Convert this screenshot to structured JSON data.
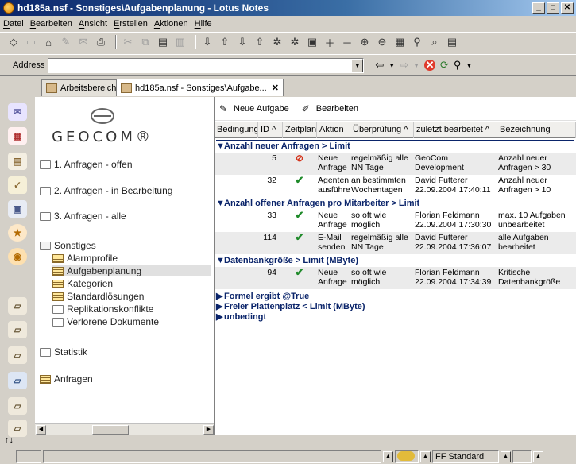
{
  "window": {
    "title": "hd185a.nsf - Sonstiges\\Aufgabenplanung - Lotus Notes",
    "min_label": "_",
    "max_label": "□",
    "close_label": "✕"
  },
  "menu": [
    "Datei",
    "Bearbeiten",
    "Ansicht",
    "Erstellen",
    "Aktionen",
    "Hilfe"
  ],
  "toolbar": {
    "icons": [
      "diamond-icon",
      "save-icon",
      "open-icon",
      "edit-icon",
      "mail-icon",
      "print-icon",
      "cut-icon",
      "copy-icon",
      "paste-icon",
      "paste-special-icon",
      "collapse-icon",
      "expand-icon",
      "next-icon",
      "previous-icon",
      "next-unread-icon",
      "previous-unread-icon",
      "view-toggle-icon",
      "expand-all-icon",
      "collapse-all-icon",
      "expand-section-icon",
      "collapse-section-icon",
      "table-icon",
      "find-icon",
      "search-icon",
      "document-icon"
    ]
  },
  "address": {
    "label": "Address",
    "value": ""
  },
  "tabs": [
    {
      "label": "Arbeitsbereich"
    },
    {
      "label": "hd185a.nsf - Sonstiges\\Aufgabe..."
    }
  ],
  "navigator": {
    "logo": "GEOCOM®",
    "items": [
      {
        "label": "1. Anfragen - offen",
        "type": "folder"
      },
      {
        "label": "2. Anfragen - in Bearbeitung",
        "type": "folder"
      },
      {
        "label": "3. Anfragen - alle",
        "type": "folder"
      },
      {
        "label": "Sonstiges",
        "type": "folder-open"
      },
      {
        "label": "Alarmprofile",
        "type": "view"
      },
      {
        "label": "Aufgabenplanung",
        "type": "view",
        "selected": true
      },
      {
        "label": "Kategorien",
        "type": "view"
      },
      {
        "label": "Standardlösungen",
        "type": "view"
      },
      {
        "label": "Replikationskonflikte",
        "type": "folder"
      },
      {
        "label": "Verlorene Dokumente",
        "type": "folder"
      },
      {
        "label": "Statistik",
        "type": "folder"
      },
      {
        "label": "Anfragen",
        "type": "view"
      }
    ]
  },
  "actions": {
    "new_task": "Neue Aufgabe",
    "edit": "Bearbeiten"
  },
  "columns": [
    "Bedingung",
    "ID",
    "Zeitplan",
    "Aktion",
    "Überprüfung",
    "zuletzt bearbeitet",
    "Bezeichnung"
  ],
  "sort_arrow": "^",
  "categories": [
    {
      "label": "Anzahl neuer Anfragen > Limit",
      "expanded": true,
      "rows": [
        {
          "id": "5",
          "status": "noentry",
          "aktion": "Neue Anfrage",
          "pruefung": "regelmäßig alle NN Tage",
          "bearbeitet": "GeoCom Development",
          "bezeichnung": "Anzahl neuer Anfragen > 30"
        },
        {
          "id": "32",
          "status": "check",
          "aktion": "Agenten ausführen",
          "pruefung": "an bestimmten Wochentagen",
          "bearbeitet": "David Futterer 22.09.2004 17:40:11",
          "bezeichnung": "Anzahl neuer Anfragen > 10"
        }
      ]
    },
    {
      "label": "Anzahl offener Anfragen pro Mitarbeiter > Limit",
      "expanded": true,
      "rows": [
        {
          "id": "33",
          "status": "check",
          "aktion": "Neue Anfrage",
          "pruefung": "so oft wie möglich",
          "bearbeitet": "Florian Feldmann 22.09.2004 17:30:30",
          "bezeichnung": "max. 10 Aufgaben unbearbeitet"
        },
        {
          "id": "114",
          "status": "check",
          "aktion": "E-Mail senden",
          "pruefung": "regelmäßig alle NN Tage",
          "bearbeitet": "David Futterer 22.09.2004 17:36:07",
          "bezeichnung": "alle Aufgaben bearbeitet"
        }
      ]
    },
    {
      "label": "Datenbankgröße > Limit (MByte)",
      "expanded": true,
      "rows": [
        {
          "id": "94",
          "status": "check",
          "aktion": "Neue Anfrage",
          "pruefung": "so oft wie möglich",
          "bearbeitet": "Florian Feldmann 22.09.2004 17:34:39",
          "bezeichnung": "Kritische Datenbankgröße"
        }
      ]
    },
    {
      "label": "Formel ergibt @True",
      "expanded": false,
      "rows": []
    },
    {
      "label": "Freier Plattenplatz < Limit (MByte)",
      "expanded": false,
      "rows": []
    },
    {
      "label": "unbedingt",
      "expanded": false,
      "rows": []
    }
  ],
  "status": {
    "location": "FF Standard"
  },
  "colors": {
    "title_bar": "#0a246a",
    "category_text": "#0a246a",
    "check": "#1f8a2a",
    "noentry": "#d4341c"
  }
}
